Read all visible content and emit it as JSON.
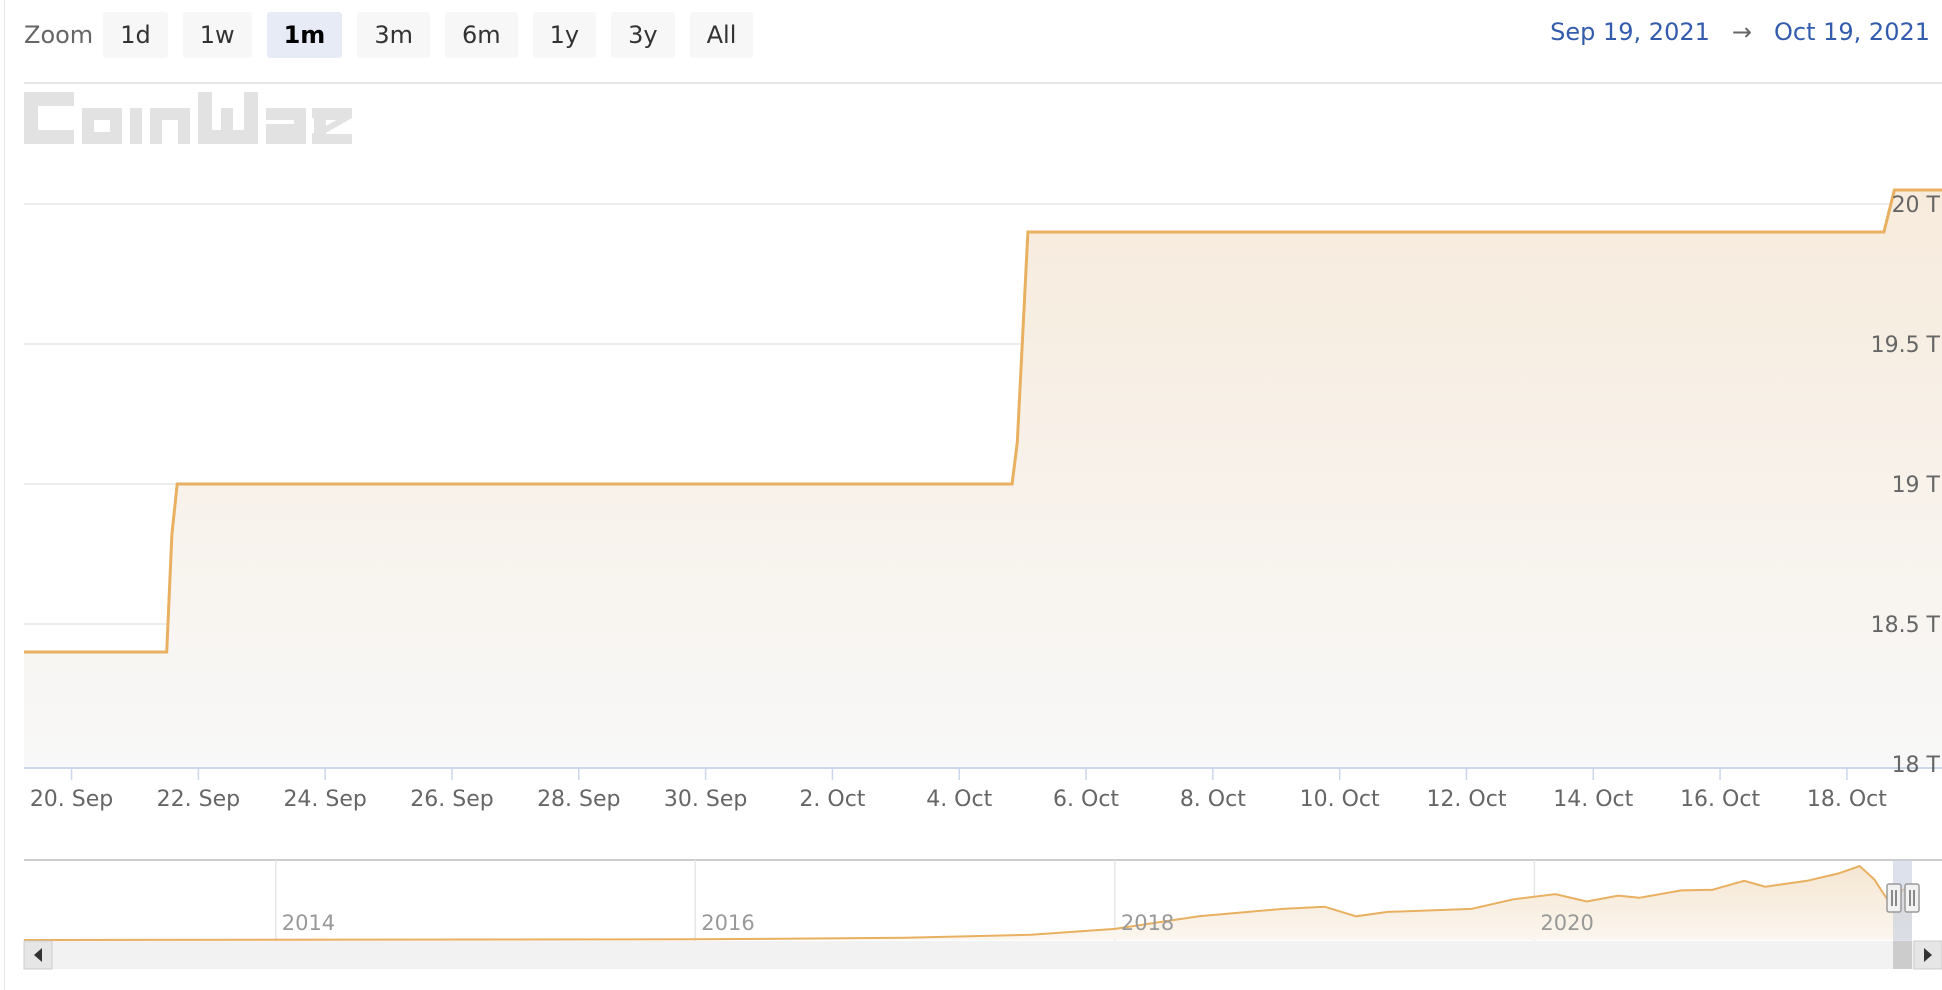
{
  "zoom": {
    "label": "Zoom",
    "buttons": [
      "1d",
      "1w",
      "1m",
      "3m",
      "6m",
      "1y",
      "3y",
      "All"
    ],
    "active": "1m"
  },
  "range": {
    "from": "Sep 19, 2021",
    "arrow": "→",
    "to": "Oct 19, 2021"
  },
  "watermark": "CoinWarz",
  "colors": {
    "series": "#e8b060",
    "fill_top": "#f7ebdc",
    "fill_bottom": "#f8f8f8",
    "grid": "#e6e6e6",
    "button_active": "#e6ebf5",
    "range_text": "#335cad"
  },
  "chart_data": {
    "type": "area",
    "x_unit": "day of month (Sep 19 - Oct 19, 2021)",
    "series": [
      {
        "values": [
          [
            "2021-09-19T06:00",
            18.4
          ],
          [
            "2021-09-21T12:00",
            18.4
          ],
          [
            "2021-09-21T14:00",
            18.82
          ],
          [
            "2021-09-21T16:00",
            19.0
          ],
          [
            "2021-10-04T20:00",
            19.0
          ],
          [
            "2021-10-04T22:00",
            19.15
          ],
          [
            "2021-10-05T02:00",
            19.9
          ],
          [
            "2021-10-18T14:00",
            19.9
          ],
          [
            "2021-10-18T18:00",
            20.05
          ],
          [
            "2021-10-19T12:00",
            20.05
          ]
        ]
      }
    ],
    "y_unit": "T",
    "yticks": [
      18,
      18.5,
      19,
      19.5,
      20
    ],
    "ytick_labels": [
      "18 T",
      "18.5 T",
      "19 T",
      "19.5 T",
      "20 T"
    ],
    "ylim": [
      18,
      20.2
    ],
    "xticks": [
      {
        "date": "2021-09-20",
        "label": "20. Sep"
      },
      {
        "date": "2021-09-22",
        "label": "22. Sep"
      },
      {
        "date": "2021-09-24",
        "label": "24. Sep"
      },
      {
        "date": "2021-09-26",
        "label": "26. Sep"
      },
      {
        "date": "2021-09-28",
        "label": "28. Sep"
      },
      {
        "date": "2021-09-30",
        "label": "30. Sep"
      },
      {
        "date": "2021-10-02",
        "label": "2. Oct"
      },
      {
        "date": "2021-10-04",
        "label": "4. Oct"
      },
      {
        "date": "2021-10-06",
        "label": "6. Oct"
      },
      {
        "date": "2021-10-08",
        "label": "8. Oct"
      },
      {
        "date": "2021-10-10",
        "label": "10. Oct"
      },
      {
        "date": "2021-10-12",
        "label": "12. Oct"
      },
      {
        "date": "2021-10-14",
        "label": "14. Oct"
      },
      {
        "date": "2021-10-16",
        "label": "16. Oct"
      },
      {
        "date": "2021-10-18",
        "label": "18. Oct"
      }
    ],
    "grid": true,
    "navigator": {
      "labels": [
        "2014",
        "2016",
        "2018",
        "2020"
      ],
      "series_relative": [
        [
          2012.8,
          0.0
        ],
        [
          2016.0,
          0.01
        ],
        [
          2017.0,
          0.03
        ],
        [
          2017.6,
          0.07
        ],
        [
          2018.0,
          0.15
        ],
        [
          2018.4,
          0.32
        ],
        [
          2018.8,
          0.42
        ],
        [
          2019.0,
          0.45
        ],
        [
          2019.15,
          0.32
        ],
        [
          2019.3,
          0.38
        ],
        [
          2019.7,
          0.42
        ],
        [
          2019.9,
          0.55
        ],
        [
          2020.1,
          0.62
        ],
        [
          2020.25,
          0.52
        ],
        [
          2020.4,
          0.6
        ],
        [
          2020.5,
          0.57
        ],
        [
          2020.7,
          0.67
        ],
        [
          2020.85,
          0.68
        ],
        [
          2021.0,
          0.8
        ],
        [
          2021.1,
          0.72
        ],
        [
          2021.3,
          0.8
        ],
        [
          2021.45,
          0.9
        ],
        [
          2021.55,
          1.0
        ],
        [
          2021.62,
          0.82
        ],
        [
          2021.68,
          0.56
        ],
        [
          2021.72,
          0.62
        ],
        [
          2021.8,
          0.74
        ]
      ]
    }
  }
}
